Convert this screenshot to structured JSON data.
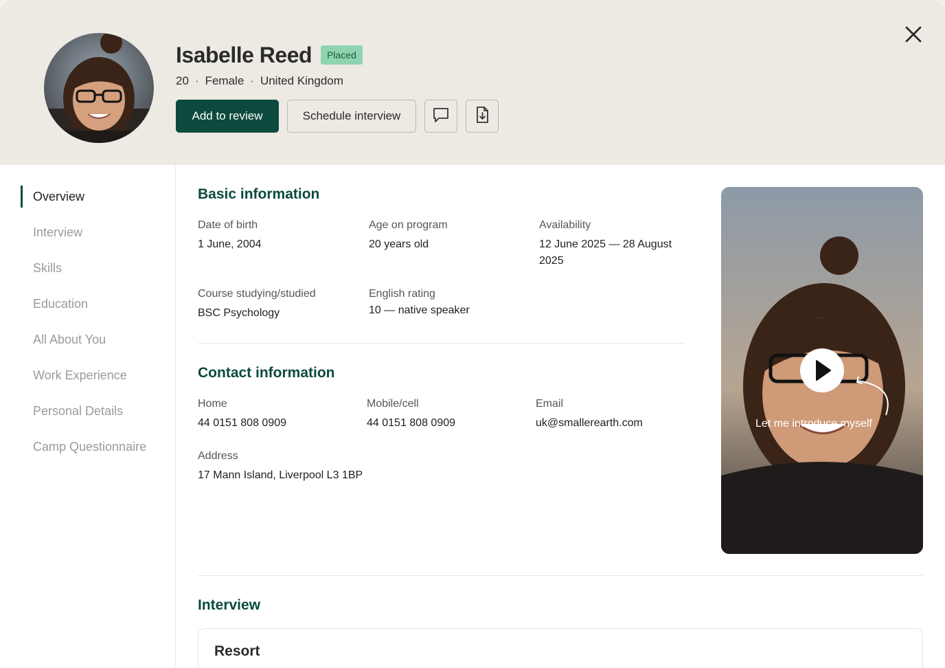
{
  "profile": {
    "name": "Isabelle Reed",
    "status": "Placed",
    "age": "20",
    "gender": "Female",
    "country": "United Kingdom",
    "meta_separator": "·"
  },
  "actions": {
    "add_review": "Add to review",
    "schedule_interview": "Schedule interview",
    "message_icon": "message-icon",
    "download_icon": "download-file-icon",
    "close_icon": "close-icon"
  },
  "sidebar": {
    "items": [
      {
        "label": "Overview",
        "active": true
      },
      {
        "label": "Interview"
      },
      {
        "label": "Skills"
      },
      {
        "label": "Education"
      },
      {
        "label": "All About You"
      },
      {
        "label": "Work Experience"
      },
      {
        "label": "Personal Details"
      },
      {
        "label": "Camp Questionnaire"
      }
    ]
  },
  "basic": {
    "title": "Basic information",
    "dob_label": "Date of birth",
    "dob": "1 June, 2004",
    "age_label": "Age on program",
    "age": "20 years old",
    "availability_label": "Availability",
    "availability_line1": "12 June 2025 — 28 August",
    "availability_line2": "2025",
    "course_label": "Course studying/studied",
    "course": "BSC Psychology",
    "english_label": "English rating",
    "english": "10 — native speaker"
  },
  "contact": {
    "title": "Contact information",
    "home_label": "Home",
    "home": "44 0151 808 0909",
    "mobile_label": "Mobile/cell",
    "mobile": "44 0151 808 0909",
    "email_label": "Email",
    "email": "uk@smallerearth.com",
    "address_label": "Address",
    "address": "17 Mann Island, Liverpool L3 1BP"
  },
  "video": {
    "caption": "Let me introduce myself",
    "play_icon": "play-icon"
  },
  "interview": {
    "title": "Interview",
    "card_title": "Resort"
  },
  "colors": {
    "brand": "#0b4a3d",
    "header_bg": "#edeae3",
    "badge_bg": "#8fd4b0"
  }
}
